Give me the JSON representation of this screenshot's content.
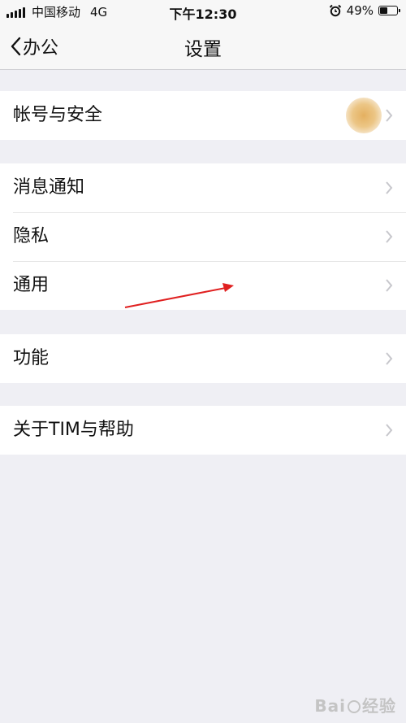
{
  "status_bar": {
    "carrier": "中国移动",
    "network": "4G",
    "time": "下午12:30",
    "battery": "49%",
    "battery_level": 0.49,
    "alarm_icon": "alarm-icon"
  },
  "nav": {
    "back_label": "办公",
    "title": "设置"
  },
  "groups": [
    {
      "items": [
        {
          "label": "帐号与安全",
          "has_avatar": true
        }
      ]
    },
    {
      "items": [
        {
          "label": "消息通知"
        },
        {
          "label": "隐私"
        },
        {
          "label": "通用"
        }
      ]
    },
    {
      "items": [
        {
          "label": "功能"
        }
      ]
    },
    {
      "items": [
        {
          "label": "关于TIM与帮助"
        }
      ]
    }
  ],
  "annotation": {
    "arrow_color": "#e02020"
  },
  "watermark": {
    "brand_a": "Bai",
    "brand_b": "经验"
  },
  "colors": {
    "background": "#efeff4",
    "cell": "#ffffff",
    "chevron": "#c7c7cc"
  }
}
